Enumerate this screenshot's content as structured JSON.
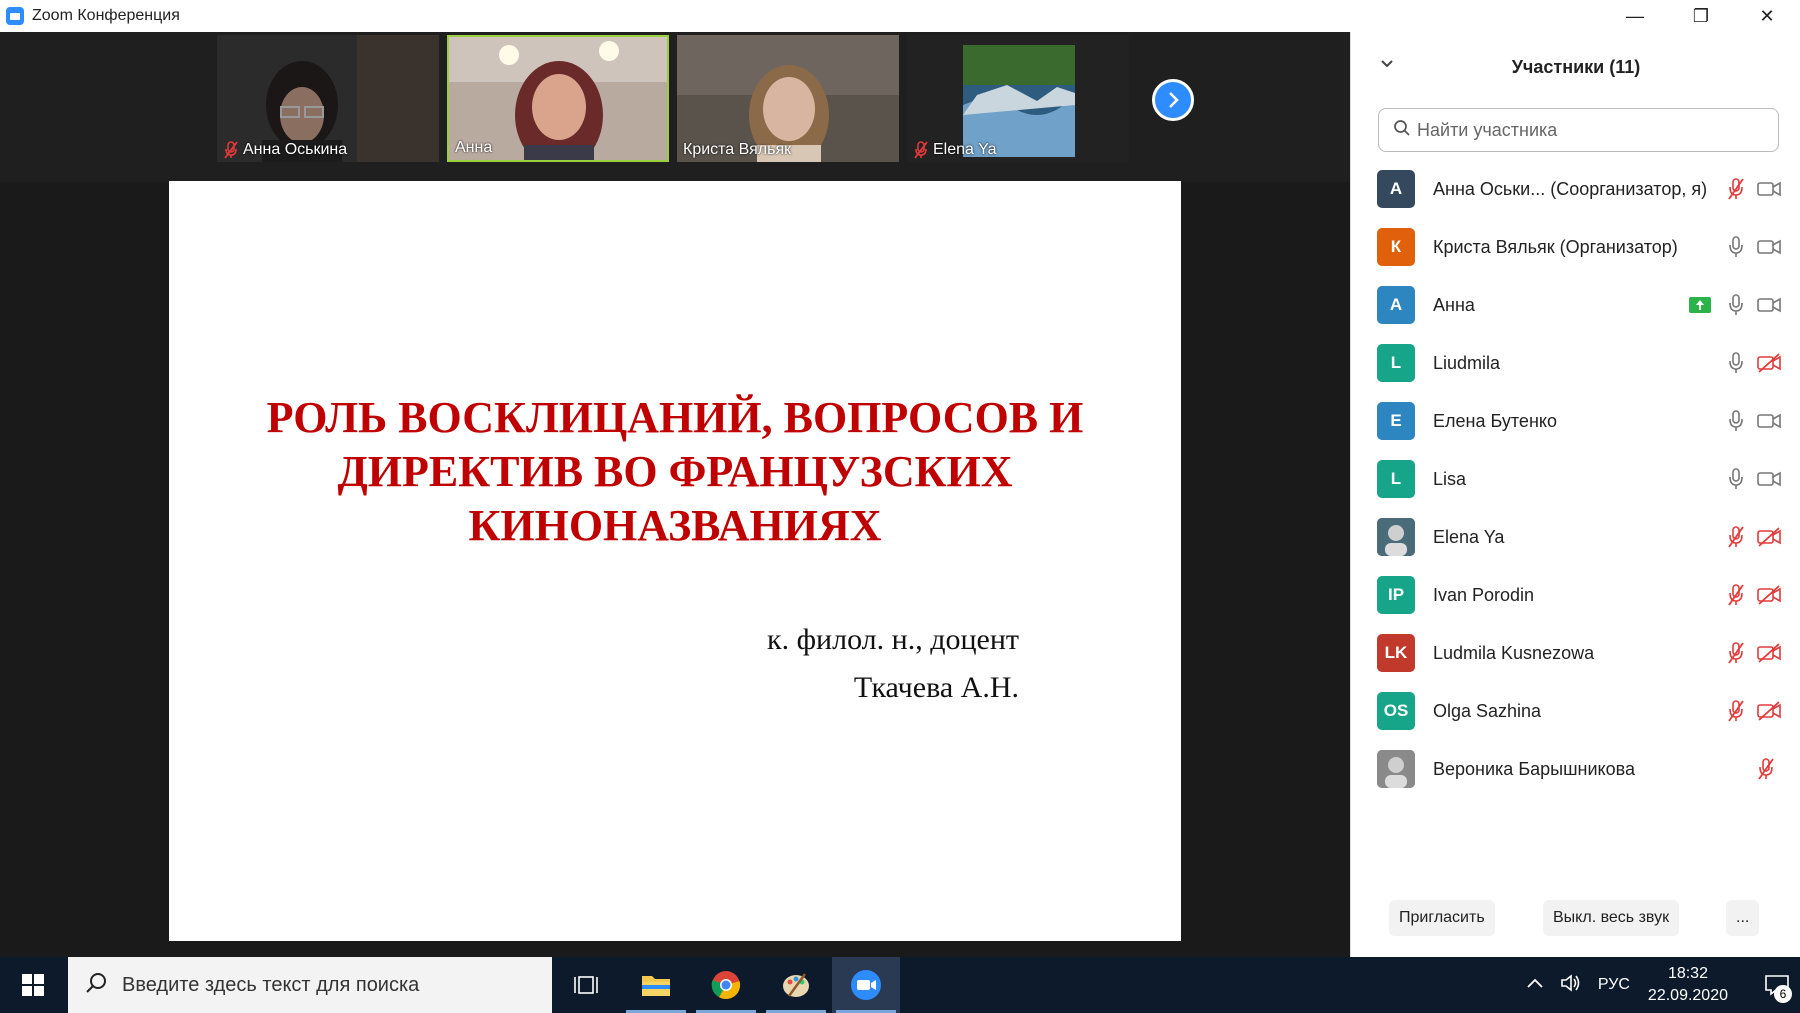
{
  "window": {
    "title": "Zoom Конференция",
    "minimize": "—",
    "restore": "❐",
    "close": "✕"
  },
  "thumbnails": [
    {
      "name": "Анна Оськина",
      "muted": true
    },
    {
      "name": "Анна",
      "muted": false,
      "active": true
    },
    {
      "name": "Криста Вяльяк",
      "muted": false
    },
    {
      "name": "Elena Ya",
      "muted": true
    }
  ],
  "slide": {
    "title_lines": [
      "РОЛЬ ВОСКЛИЦАНИЙ, ВОПРОСОВ И",
      "ДИРЕКТИВ ВО ФРАНЦУЗСКИХ",
      "КИНОНАЗВАНИЯХ"
    ],
    "author_lines": [
      "к. филол. н., доцент",
      "Ткачева А.Н."
    ]
  },
  "panel": {
    "title": "Участники (11)",
    "search_placeholder": "Найти участника",
    "participants": [
      {
        "initials": "А",
        "color": "#34495e",
        "name": "Анна Оськи...  (Соорганизатор, я)",
        "mic": "off",
        "cam": "on"
      },
      {
        "initials": "К",
        "color": "#e0600b",
        "name": "Криста Вяльяк (Организатор)",
        "mic": "on",
        "cam": "on"
      },
      {
        "initials": "А",
        "color": "#2e86c1",
        "name": "Анна",
        "mic": "on",
        "cam": "on",
        "sharing": true
      },
      {
        "initials": "L",
        "color": "#17a589",
        "name": "Liudmila",
        "mic": "on",
        "cam": "off"
      },
      {
        "initials": "Е",
        "color": "#2e86c1",
        "name": "Елена Бутенко",
        "mic": "on",
        "cam": "on"
      },
      {
        "initials": "L",
        "color": "#17a589",
        "name": "Lisa",
        "mic": "on",
        "cam": "on"
      },
      {
        "initials": "",
        "color": "#4a6b7a",
        "name": "Elena Ya",
        "mic": "off",
        "cam": "off",
        "photo": true
      },
      {
        "initials": "IP",
        "color": "#17a589",
        "name": "Ivan Porodin",
        "mic": "off",
        "cam": "off"
      },
      {
        "initials": "LK",
        "color": "#c0392b",
        "name": "Ludmila Kusnezowa",
        "mic": "off",
        "cam": "off"
      },
      {
        "initials": "OS",
        "color": "#17a589",
        "name": "Olga Sazhina",
        "mic": "off",
        "cam": "off"
      },
      {
        "initials": "",
        "color": "#8a8a8a",
        "name": "Вероника Барышникова",
        "mic": "off",
        "cam": "none",
        "photo": true
      }
    ],
    "invite": "Пригласить",
    "mute_all": "Выкл. весь звук",
    "more": "..."
  },
  "taskbar": {
    "search_text": "Введите здесь текст для поиска",
    "language": "РУС",
    "time": "18:32",
    "date": "22.09.2020",
    "notifications": "6"
  }
}
